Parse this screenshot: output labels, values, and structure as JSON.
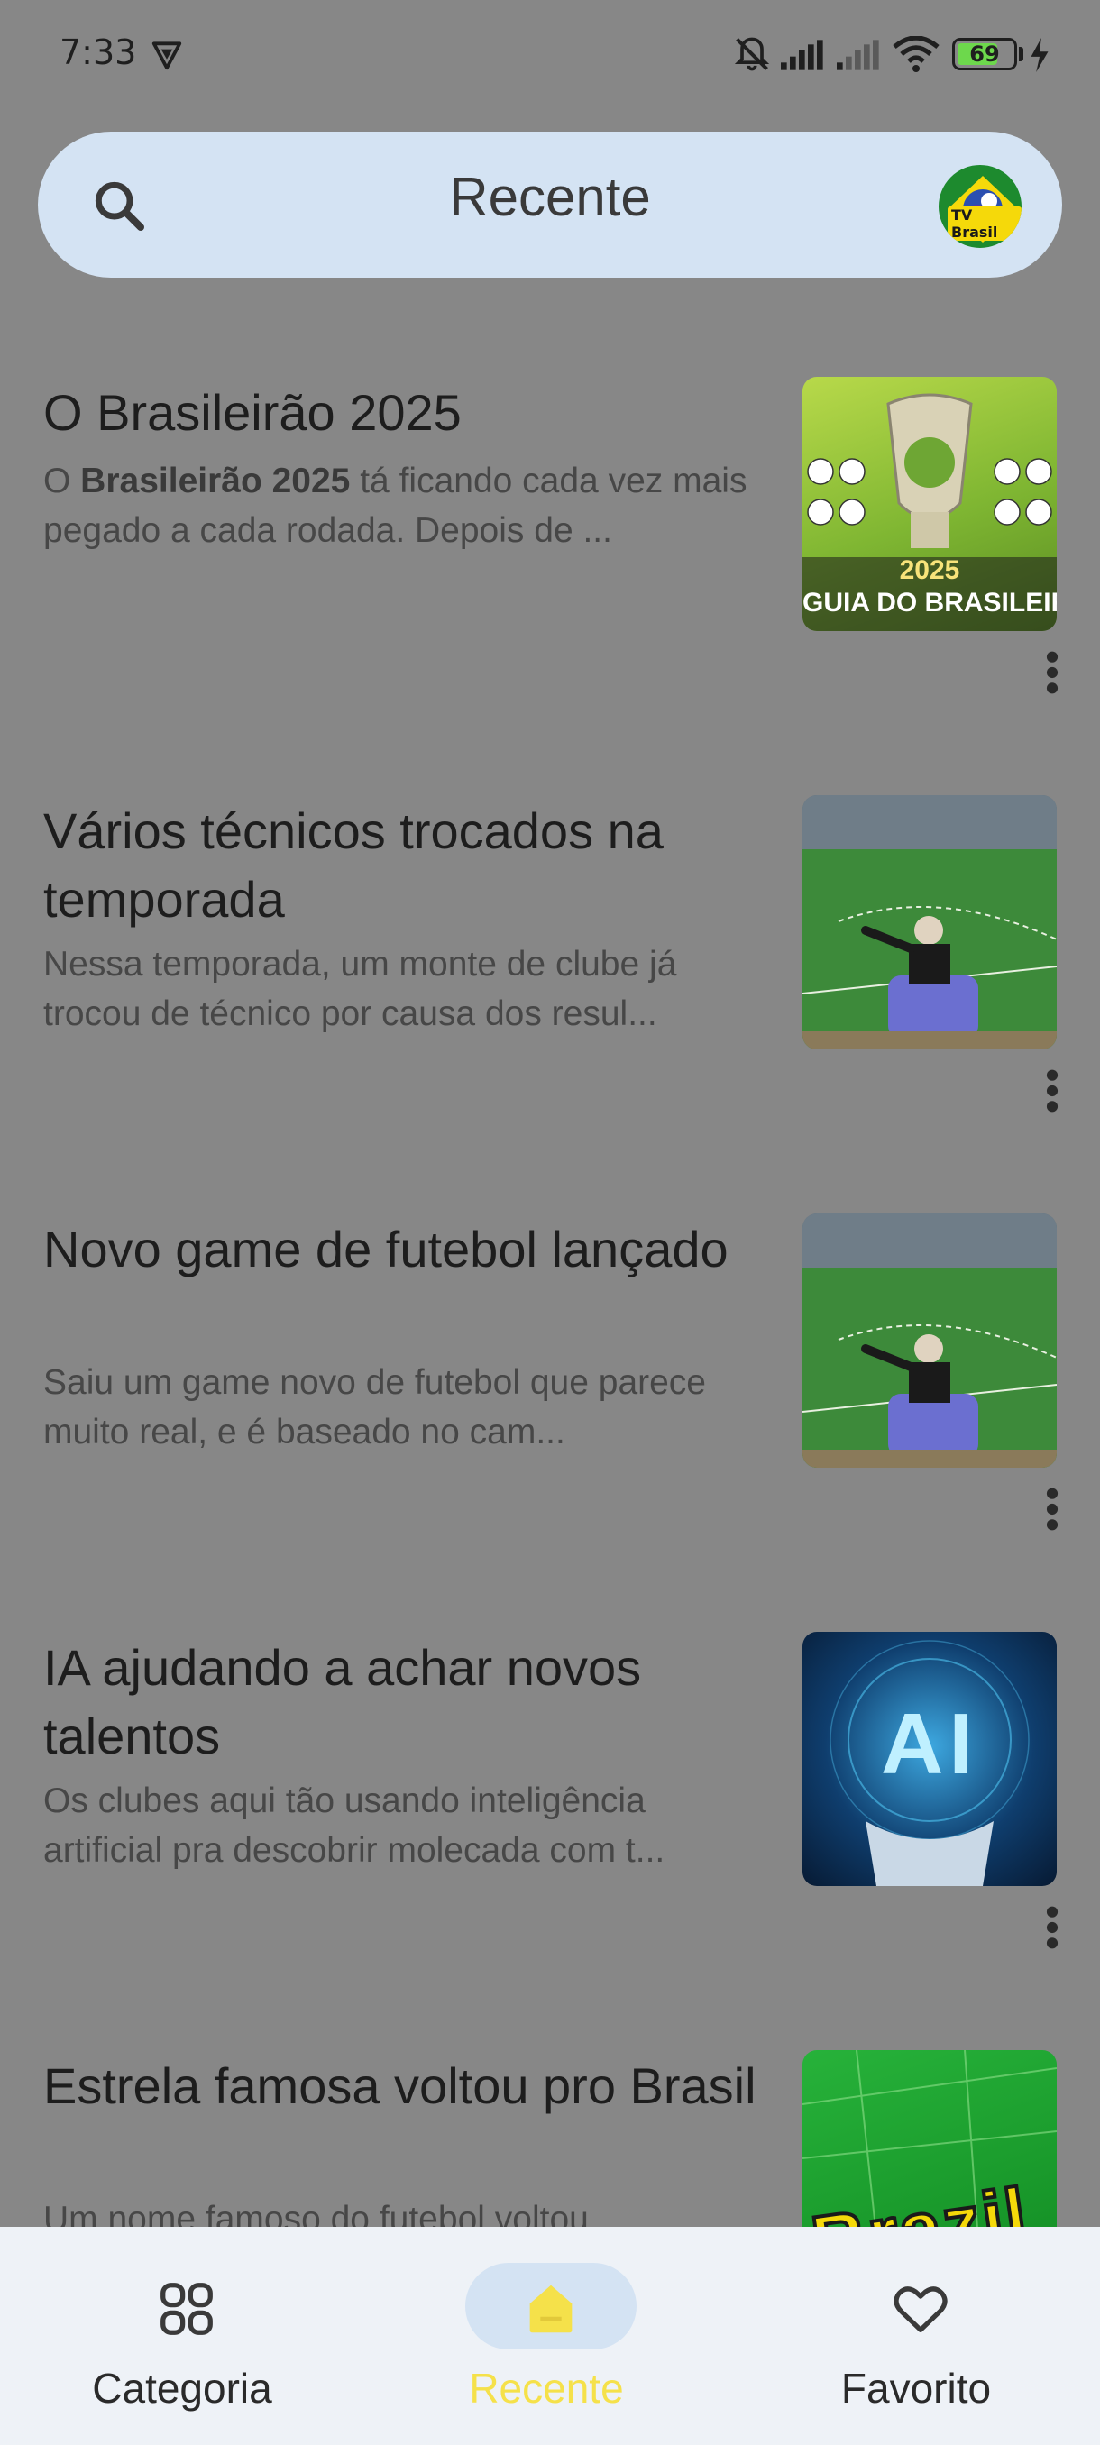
{
  "status_bar": {
    "time": "7:33",
    "battery": "69"
  },
  "header": {
    "title": "Recente",
    "logo_text": "TV Brasil"
  },
  "articles": [
    {
      "title": "O Brasileirão 2025",
      "summary_bold": "Brasileirão 2025",
      "summary_pre": "O ",
      "summary_post": " tá ficando cada vez mais pegado a cada rodada. Depois de ...",
      "thumb_year": "2025",
      "thumb_caption": "GUIA DO BRASILEIRÃO"
    },
    {
      "title": "Vários técnicos trocados na temporada",
      "summary": "Nessa temporada, um monte de clube já trocou de técnico por causa dos resul..."
    },
    {
      "title": "Novo game de futebol lançado",
      "summary": "Saiu um game novo de futebol que parece muito real, e é baseado no cam..."
    },
    {
      "title": "IA ajudando a achar novos talentos",
      "summary": "Os clubes aqui tão usando inteligência artificial pra descobrir molecada com t...",
      "thumb_text": "AI"
    },
    {
      "title": "Estrela famosa voltou pro Brasil",
      "summary": "Um nome famoso do futebol voltou",
      "thumb_text": "Brazil"
    }
  ],
  "bottom_nav": {
    "items": [
      {
        "label": "Categoria",
        "icon": "grid-icon",
        "active": false
      },
      {
        "label": "Recente",
        "icon": "home-icon",
        "active": true
      },
      {
        "label": "Favorito",
        "icon": "heart-icon",
        "active": false
      }
    ],
    "active_color": "#f5e14a"
  },
  "colors": {
    "background": "#878787",
    "search_bar": "#d4e3f3",
    "nav_bar": "#eef2f7"
  }
}
